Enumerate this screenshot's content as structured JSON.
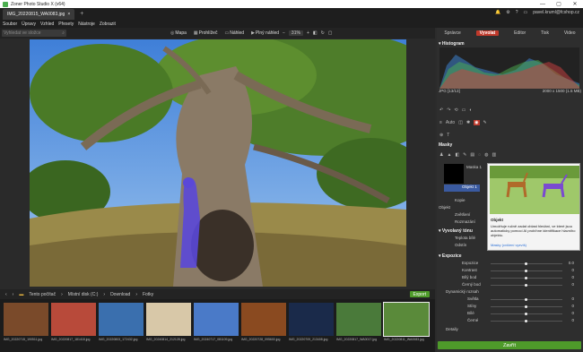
{
  "window": {
    "title": "Zoner Photo Studio X (v64)",
    "controls": [
      "—",
      "▢",
      "✕"
    ]
  },
  "tab": {
    "label": "IMG_20220815_WA0083.jpg",
    "plus": "+"
  },
  "user": {
    "email": "pavel.kruml@fcshop.cz",
    "icons": [
      "🔔",
      "⚙",
      "?",
      "▭"
    ]
  },
  "menu": [
    "Soubor",
    "Úpravy",
    "Vzhled",
    "Přesety",
    "Nástroje",
    "Zobrazit"
  ],
  "toolbar": {
    "search_placeholder": "Vyhledat ve složce",
    "items": [
      {
        "icon": "map-icon",
        "glyph": "◎",
        "label": "Mapa"
      },
      {
        "icon": "browser-icon",
        "glyph": "▦",
        "label": "Prohlížeč"
      },
      {
        "icon": "view-icon",
        "glyph": "▭",
        "label": "Náhled"
      },
      {
        "icon": "fullscreen-icon",
        "glyph": "▶",
        "label": "Plný náhled"
      }
    ],
    "zoom": "31%"
  },
  "modes": [
    "Správce",
    "Vyvolat",
    "Editor",
    "Tisk",
    "Video"
  ],
  "active_mode": "Vyvolat",
  "histogram": {
    "title": "Histogram",
    "format": "JPG",
    "info": "[13/13]",
    "dimensions": "2000 x 1500 (1.5 MB)"
  },
  "auto_label": "Auto",
  "masks": {
    "title": "Masky",
    "mask_label": "Maska 1",
    "object_label": "Objekt 1",
    "rows": [
      "Kopie",
      "Objekt",
      "Zvětšení",
      "Rozmazání"
    ]
  },
  "develop": {
    "title": "Vyvolaný tónu",
    "rows": [
      "Teplota bílé",
      "Odstín"
    ]
  },
  "exposure": {
    "title": "Expozice",
    "rows": [
      {
        "label": "Expozice",
        "value": "0.0"
      },
      {
        "label": "Kontrast",
        "value": "0"
      },
      {
        "label": "Bílý bod",
        "value": "0"
      },
      {
        "label": "Černý bod",
        "value": "0"
      }
    ],
    "dyn_label": "Dynamický rozsah",
    "dyn_rows": [
      {
        "label": "Světla",
        "value": "0"
      },
      {
        "label": "Stíny",
        "value": "0"
      },
      {
        "label": "Bílé",
        "value": "0"
      },
      {
        "label": "Černé",
        "value": "0"
      }
    ],
    "details": "Detaily"
  },
  "apply_label": "Zavřít",
  "tooltip": {
    "title": "Objekt",
    "body": "Umožňuje ručně zadat oblast hledání, ve které jsou automaticky pomocí AI probíhne identifikace hlavního objektu.",
    "link": "Masky (cvičení vyzvíš)"
  },
  "filmstrip": {
    "path": [
      "Tento počítač",
      "Místní disk (C:)",
      "Download",
      "Fotky"
    ],
    "export_label": "Export",
    "thumbs": [
      {
        "caption": "IMG_20220715_190511.jpg",
        "color": "#7a4a2a"
      },
      {
        "caption": "IMG_20220817_181418.jpg",
        "color": "#b84a3a"
      },
      {
        "caption": "IMG_20220803_172432.jpg",
        "color": "#3a6fae"
      },
      {
        "caption": "IMG_20240814_212128.jpg",
        "color": "#d8c8a8"
      },
      {
        "caption": "IMG_20240717_081109.jpg",
        "color": "#4a7ac8"
      },
      {
        "caption": "IMG_20220728_095600.jpg",
        "color": "#8a4a20"
      },
      {
        "caption": "IMG_20220709_213408.jpg",
        "color": "#1a2a4a"
      },
      {
        "caption": "IMG_20220817_WA0017.jpg",
        "color": "#4a7a3a"
      },
      {
        "caption": "IMG_20220811_WA0083.jpg",
        "color": "#5a8a3a"
      }
    ]
  },
  "colors": {
    "accent": "#c0392b",
    "apply": "#4e9a2a",
    "mask": "#5a4ad0"
  }
}
